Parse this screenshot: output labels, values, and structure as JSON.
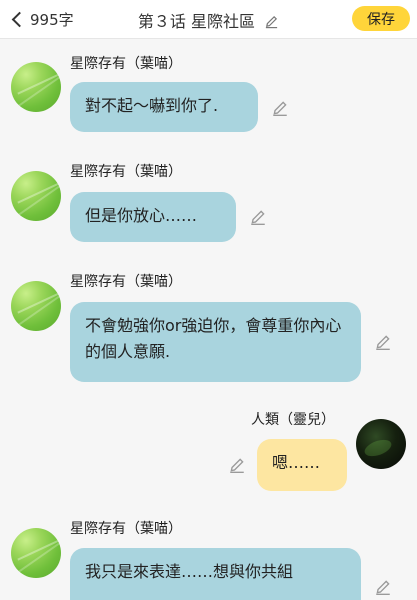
{
  "topbar": {
    "back_icon": "chevron-left-icon",
    "word_count": "995字",
    "title": "第３话 星際社區",
    "title_edit_icon": "pencil-icon",
    "save_label": "保存",
    "save_color": "#ffd53a"
  },
  "messages": [
    {
      "side": "left",
      "speaker": "星際存有（葉喵）",
      "text": "對不起～嚇到你了.",
      "bubble_color": "#a9d4de"
    },
    {
      "side": "left",
      "speaker": "星際存有（葉喵）",
      "text": "但是你放心……",
      "bubble_color": "#a9d4de"
    },
    {
      "side": "left",
      "speaker": "星際存有（葉喵）",
      "text": "不會勉強你or強迫你，會尊重你內心的個人意願.",
      "bubble_color": "#a9d4de"
    },
    {
      "side": "right",
      "speaker": "人類（靈兒）",
      "text": "嗯……",
      "bubble_color": "#fde6a1"
    },
    {
      "side": "left",
      "speaker": "星際存有（葉喵）",
      "text": "我只是來表達……想與你共組",
      "bubble_color": "#a9d4de"
    }
  ]
}
